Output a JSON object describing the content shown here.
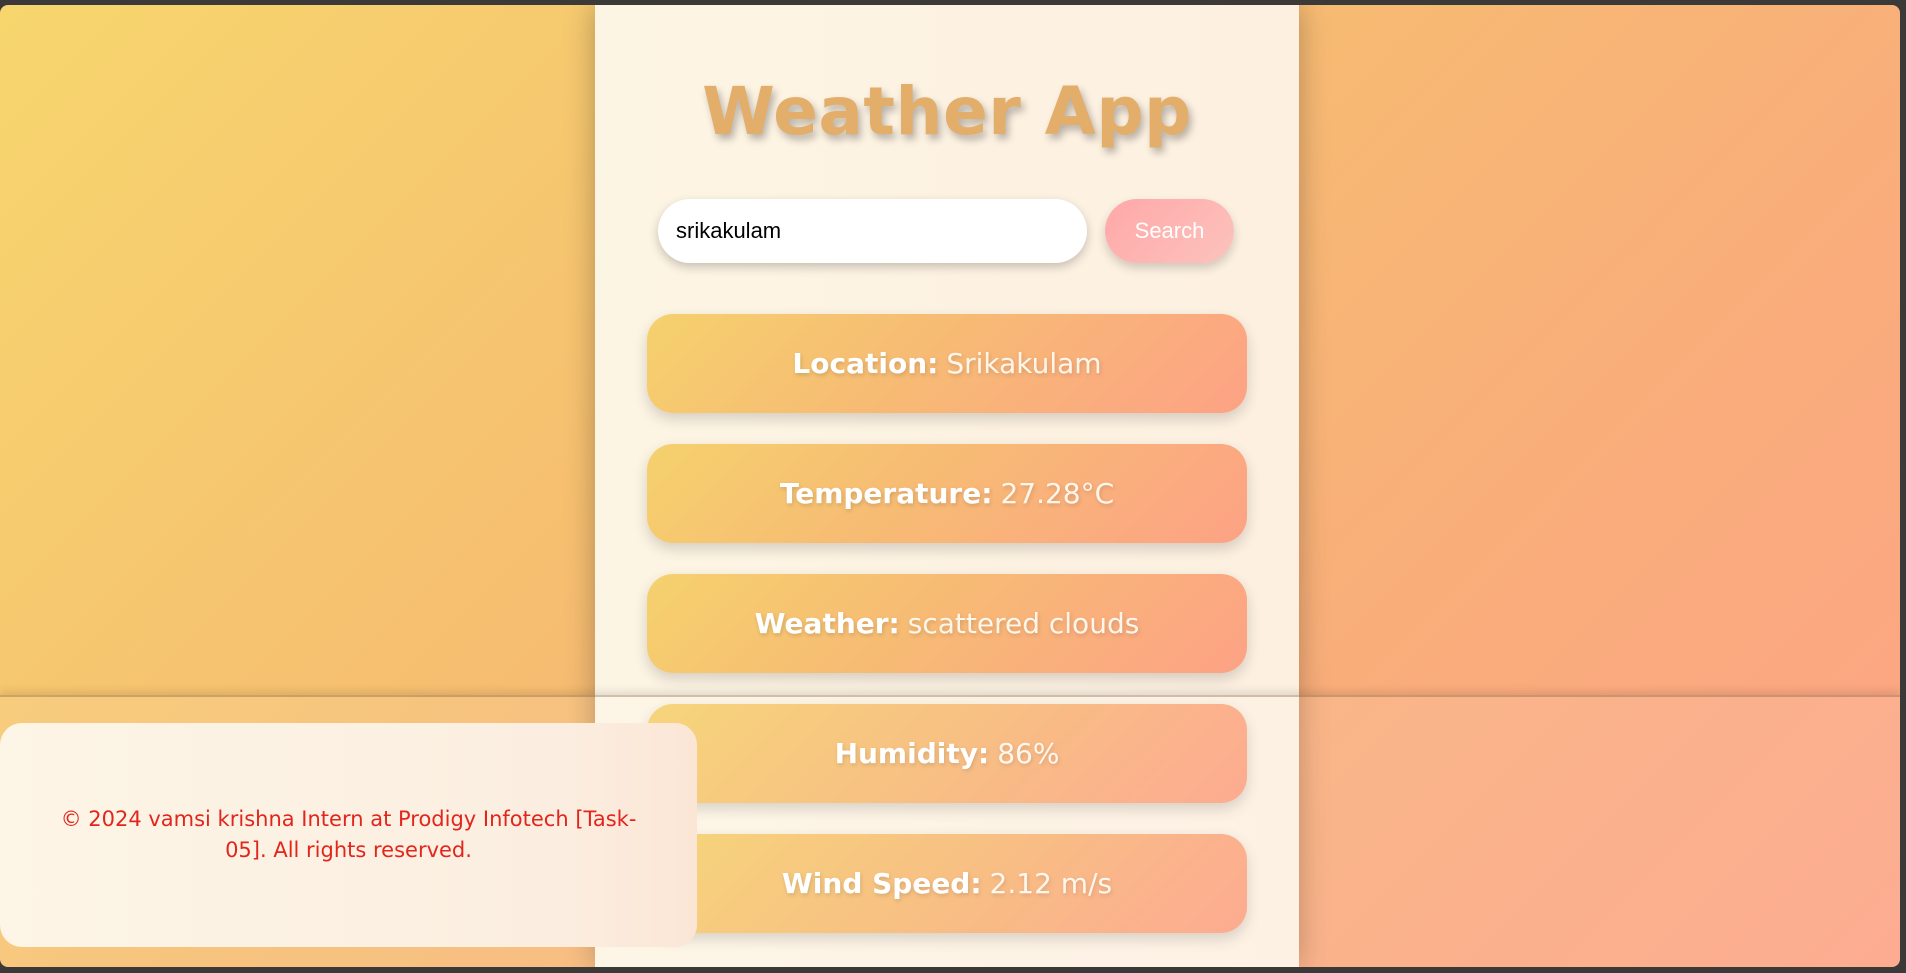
{
  "app": {
    "title": "Weather App"
  },
  "search": {
    "value": "srikakulam",
    "button_label": "Search"
  },
  "weather": {
    "location": {
      "label": "Location:",
      "value": "Srikakulam"
    },
    "temperature": {
      "label": "Temperature:",
      "value": "27.28°C"
    },
    "condition": {
      "label": "Weather:",
      "value": "scattered clouds"
    },
    "humidity": {
      "label": "Humidity:",
      "value": "86%"
    },
    "wind_speed": {
      "label": "Wind Speed:",
      "value": "2.12 m/s"
    }
  },
  "footer": {
    "text": "© 2024 vamsi krishna Intern at Prodigy Infotech [Task-05]. All rights reserved."
  },
  "colors": {
    "background_start": "#f7d66e",
    "background_end": "#fda386",
    "title": "#e3ad6a",
    "footer_text": "#e2261d",
    "search_button": "#ffa8a8"
  }
}
